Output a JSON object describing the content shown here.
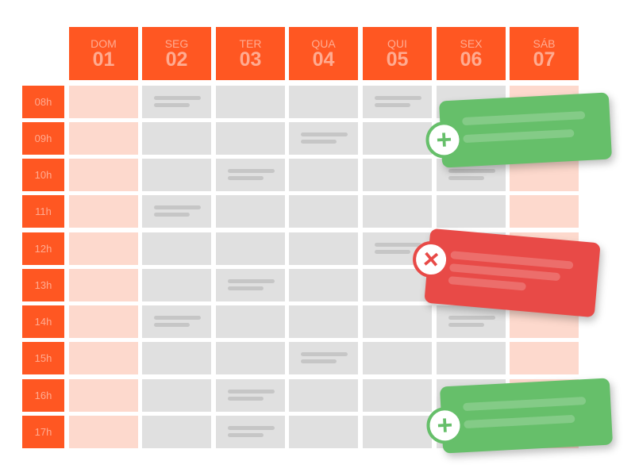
{
  "days": [
    {
      "name": "DOM",
      "date": "01"
    },
    {
      "name": "SEG",
      "date": "02"
    },
    {
      "name": "TER",
      "date": "03"
    },
    {
      "name": "QUA",
      "date": "04"
    },
    {
      "name": "QUI",
      "date": "05"
    },
    {
      "name": "SEX",
      "date": "06"
    },
    {
      "name": "SÁB",
      "date": "07"
    }
  ],
  "hours": [
    "08h",
    "09h",
    "10h",
    "11h",
    "12h",
    "13h",
    "14h",
    "15h",
    "16h",
    "17h"
  ],
  "weekend_days": [
    0,
    6
  ],
  "filled_slots": {
    "1": [
      0,
      3,
      6
    ],
    "2": [
      2,
      5,
      8,
      9
    ],
    "3": [
      1,
      7
    ],
    "4": [
      0,
      4
    ],
    "5": [
      2,
      6
    ]
  },
  "colors": {
    "header": "#ff5722",
    "weekend": "#fdd9cd",
    "slot": "#e0e0e0",
    "add": "#66bf6a",
    "remove": "#e84a47"
  },
  "cards": [
    {
      "type": "add",
      "icon": "plus-icon",
      "symbol": "+",
      "lines": 2
    },
    {
      "type": "remove",
      "icon": "close-icon",
      "symbol": "×",
      "lines": 3
    },
    {
      "type": "add",
      "icon": "plus-icon",
      "symbol": "+",
      "lines": 2
    }
  ]
}
